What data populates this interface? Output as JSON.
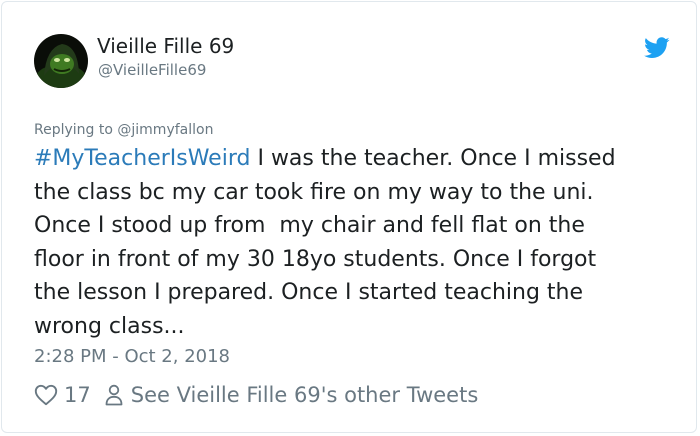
{
  "tweet": {
    "display_name": "Vieille Fille 69",
    "handle": "@VieilleFille69",
    "reply_prefix": "Replying to ",
    "reply_to": "@jimmyfallon",
    "hashtag": "#MyTeacherIsWeird",
    "body": " I was the teacher. Once I missed\nthe class bc my car took fire on my way to the uni.\nOnce I stood up from  my chair and fell flat on the\nfloor in front of my 30 18yo students. Once I forgot\nthe lesson I prepared. Once I started teaching the\nwrong class...",
    "timestamp": "2:28 PM - Oct 2, 2018",
    "like_count": "17",
    "other_tweets_label": "See Vieille Fille 69's other Tweets"
  },
  "colors": {
    "twitter_blue": "#1da1f2",
    "link_blue": "#2b7bb9",
    "muted_gray": "#697882",
    "text_dark": "#1c2022"
  },
  "icons": {
    "brand": "twitter-bird-icon",
    "like": "heart-outline-icon",
    "profile": "person-outline-icon"
  }
}
